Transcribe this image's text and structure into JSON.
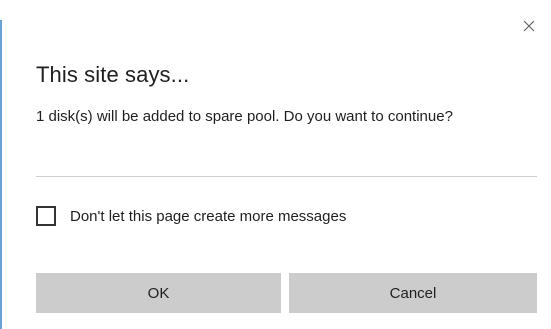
{
  "dialog": {
    "title": "This site says...",
    "message": "1 disk(s) will be added to spare pool. Do you want to continue?",
    "checkbox": {
      "label": "Don't let this page create more messages",
      "checked": false
    },
    "buttons": {
      "ok_label": "OK",
      "cancel_label": "Cancel"
    },
    "close_icon": "close-icon"
  },
  "colors": {
    "accent": "#6aa3d6",
    "button_bg": "#cccccc",
    "text": "#1f1f1f"
  }
}
